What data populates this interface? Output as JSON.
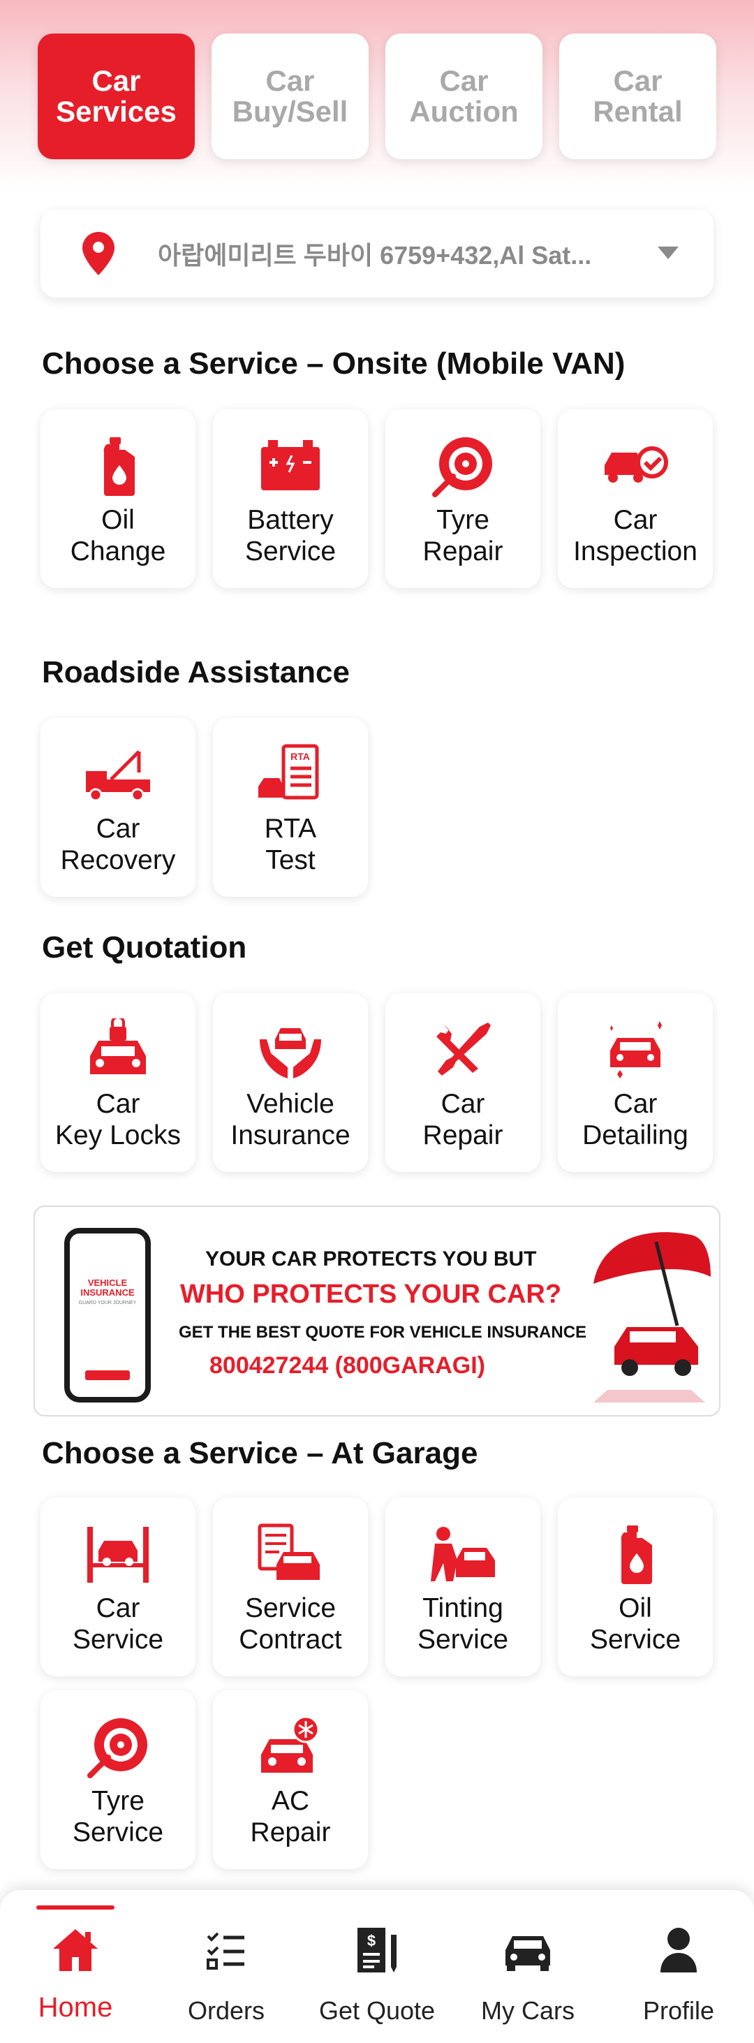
{
  "colors": {
    "accent": "#e61e2a",
    "inactive_tab_text": "#a9a9a9",
    "nav_text": "#222222"
  },
  "top_tabs": [
    {
      "label": "Car\nServices",
      "active": true
    },
    {
      "label": "Car\nBuy/Sell",
      "active": false
    },
    {
      "label": "Car\nAuction",
      "active": false
    },
    {
      "label": "Car\nRental",
      "active": false
    }
  ],
  "location": {
    "text": "아랍에미리트 두바이 6759+432,Al Sat...",
    "icon": "location-pin-icon"
  },
  "sections": {
    "onsite": {
      "title": "Choose a Service – Onsite (Mobile VAN)",
      "items": [
        {
          "label": "Oil\nChange",
          "icon": "oil-can-icon"
        },
        {
          "label": "Battery\nService",
          "icon": "battery-icon"
        },
        {
          "label": "Tyre\nRepair",
          "icon": "tyre-icon"
        },
        {
          "label": "Car\nInspection",
          "icon": "car-check-icon"
        }
      ]
    },
    "roadside": {
      "title": "Roadside Assistance",
      "items": [
        {
          "label": "Car\nRecovery",
          "icon": "tow-truck-icon"
        },
        {
          "label": "RTA\nTest",
          "icon": "rta-test-icon"
        }
      ]
    },
    "quotation": {
      "title": "Get Quotation",
      "items": [
        {
          "label": "Car\nKey Locks",
          "icon": "car-lock-icon"
        },
        {
          "label": "Vehicle\nInsurance",
          "icon": "car-hands-icon"
        },
        {
          "label": "Car\nRepair",
          "icon": "wrench-screwdriver-icon"
        },
        {
          "label": "Car\nDetailing",
          "icon": "car-sparkle-icon"
        }
      ]
    },
    "garage": {
      "title": "Choose a Service – At Garage",
      "items": [
        {
          "label": "Car\nService",
          "icon": "car-lift-icon"
        },
        {
          "label": "Service\nContract",
          "icon": "contract-car-icon"
        },
        {
          "label": "Tinting\nService",
          "icon": "tinting-icon"
        },
        {
          "label": "Oil\nService",
          "icon": "oil-can-icon"
        },
        {
          "label": "Tyre\nService",
          "icon": "tyre-icon"
        },
        {
          "label": "AC\nRepair",
          "icon": "car-ac-icon"
        }
      ]
    }
  },
  "banner": {
    "phone_title": "VEHICLE\nINSURANCE",
    "phone_sub": "GUARD YOUR JOURNEY",
    "line1": "YOUR CAR PROTECTS YOU BUT",
    "line2": "WHO PROTECTS YOUR CAR?",
    "line3": "GET THE BEST QUOTE FOR VEHICLE INSURANCE",
    "line4": "800427244 (800GARAGI)"
  },
  "bottom_nav": [
    {
      "label": "Home",
      "icon": "home-icon",
      "active": true
    },
    {
      "label": "Orders",
      "icon": "orders-checklist-icon",
      "active": false
    },
    {
      "label": "Get Quote",
      "icon": "quote-document-icon",
      "active": false
    },
    {
      "label": "My Cars",
      "icon": "car-icon",
      "active": false
    },
    {
      "label": "Profile",
      "icon": "person-icon",
      "active": false
    }
  ]
}
